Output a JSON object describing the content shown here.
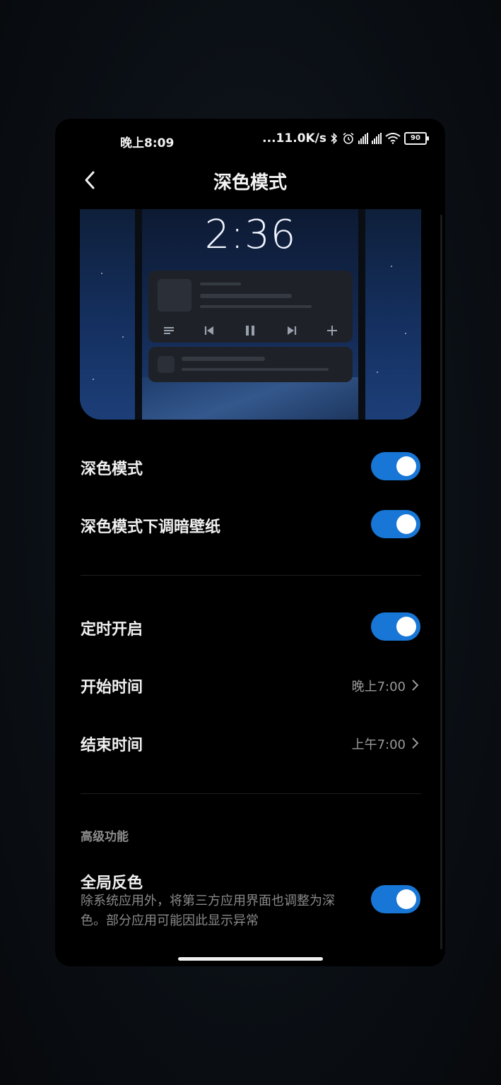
{
  "status_bar": {
    "time": "晚上8:09",
    "speed": "...11.0K/s",
    "battery": "90",
    "icons": [
      "bluetooth-icon",
      "alarm-icon",
      "hd-signal-icon",
      "hd-signal-icon",
      "wifi-icon",
      "battery-icon"
    ]
  },
  "header": {
    "title": "深色模式",
    "back_icon": "chevron-left-icon"
  },
  "preview": {
    "clock": "2:36",
    "media_controls": [
      "list-icon",
      "previous-icon",
      "pause-icon",
      "next-icon",
      "plus-icon"
    ]
  },
  "settings": {
    "dark_mode": {
      "label": "深色模式",
      "enabled": true
    },
    "dim_wallpaper": {
      "label": "深色模式下调暗壁纸",
      "enabled": true
    },
    "scheduled": {
      "label": "定时开启",
      "enabled": true
    },
    "start_time": {
      "label": "开始时间",
      "value": "晚上7:00"
    },
    "end_time": {
      "label": "结束时间",
      "value": "上午7:00"
    },
    "advanced_section": "高级功能",
    "global_invert": {
      "label": "全局反色",
      "desc_line1": "除系统应用外，将第三方应用界面也调整为深",
      "desc_line2": "色。部分应用可能因此显示异常",
      "enabled": true
    }
  },
  "colors": {
    "toggle_on": "#1877d6",
    "background": "#000000",
    "accent_text": "#f0f0f0"
  }
}
